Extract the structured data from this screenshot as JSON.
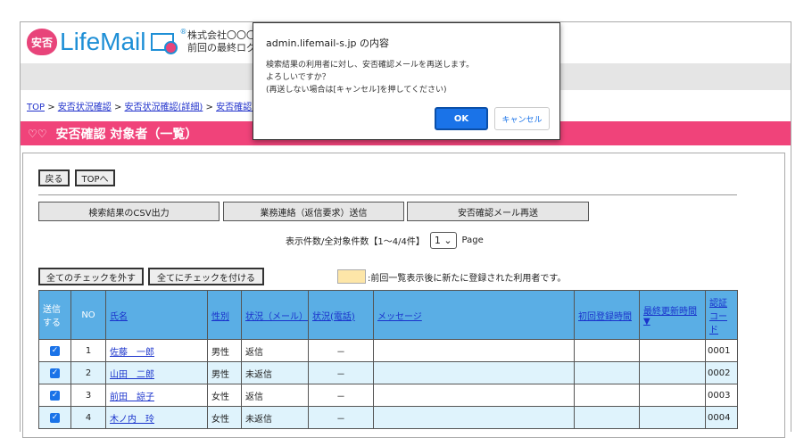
{
  "header": {
    "logo_mark": "安否",
    "brand": "LifeMail",
    "company": "株式会社〇〇〇",
    "last_login": "前回の最終ログ"
  },
  "breadcrumb": [
    "TOP",
    "安否状況確認",
    "安否状況確認(詳細)",
    "安否確認 対"
  ],
  "page_title": "安否確認 対象者（一覧）",
  "buttons": {
    "back": "戻る",
    "top": "TOPへ",
    "csv": "検索結果のCSV出力",
    "business": "業務連絡（返信要求）送信",
    "resend": "安否確認メール再送",
    "uncheck_all": "全てのチェックを外す",
    "check_all": "全てにチェックを付ける"
  },
  "pager": {
    "label": "表示件数/全対象件数【1～4/4件】",
    "page_value": "1",
    "page_suffix": "Page"
  },
  "legend": {
    "color": "#fde6a8",
    "text": ":前回一覧表示後に新たに登録された利用者です。"
  },
  "table": {
    "headers": [
      "送信する",
      "NO",
      "氏名",
      "性別",
      "状況（メール）",
      "状況(電話)",
      "メッセージ",
      "初回登録時間",
      "最終更新時間 ▼",
      "認証コード"
    ],
    "rows": [
      {
        "checked": true,
        "no": "1",
        "name": "佐藤　一郎",
        "gender": "男性",
        "mail": "返信",
        "phone": "－",
        "message": "",
        "first": "",
        "last": "",
        "code": "0001"
      },
      {
        "checked": true,
        "no": "2",
        "name": "山田　二郎",
        "gender": "男性",
        "mail": "未返信",
        "phone": "－",
        "message": "",
        "first": "",
        "last": "",
        "code": "0002"
      },
      {
        "checked": true,
        "no": "3",
        "name": "前田　諒子",
        "gender": "女性",
        "mail": "返信",
        "phone": "－",
        "message": "",
        "first": "",
        "last": "",
        "code": "0003"
      },
      {
        "checked": true,
        "no": "4",
        "name": "木ノ内　玲",
        "gender": "女性",
        "mail": "未返信",
        "phone": "－",
        "message": "",
        "first": "",
        "last": "",
        "code": "0004"
      }
    ]
  },
  "dialog": {
    "title": "admin.lifemail-s.jp の内容",
    "line1": "検索結果の利用者に対し、安否確認メールを再送します。",
    "line2": "よろしいですか？",
    "line3": "(再送しない場合は[キャンセル]を押してください)",
    "ok": "OK",
    "cancel": "キャンセル"
  },
  "colors": {
    "accent": "#f0437a",
    "table_header": "#5aaee5",
    "alt_row": "#dff3fc",
    "primary_button": "#1a73e8"
  }
}
